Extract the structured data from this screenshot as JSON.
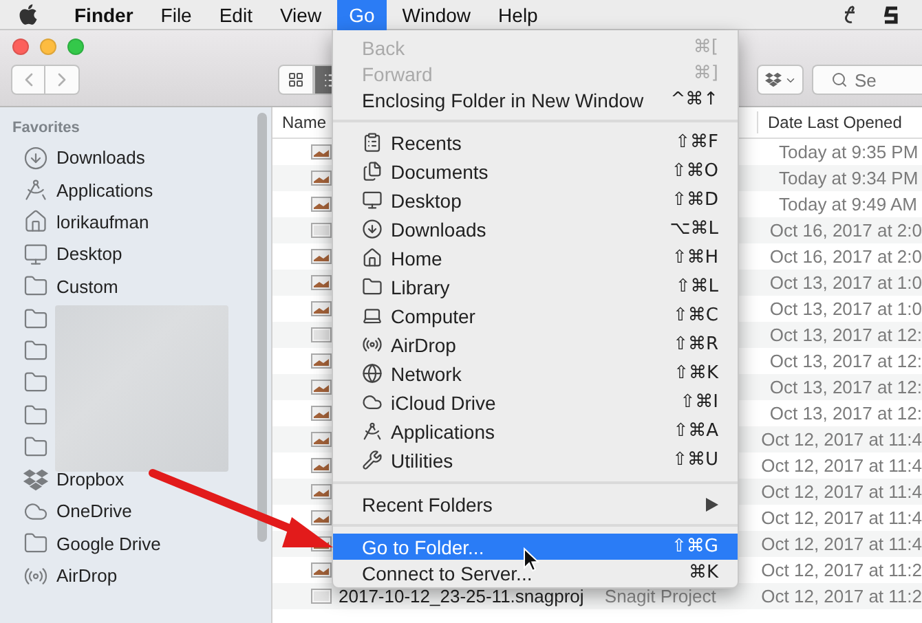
{
  "menu_bar": {
    "items": [
      {
        "label": "Finder",
        "bold": true,
        "selected": false
      },
      {
        "label": "File",
        "bold": false,
        "selected": false
      },
      {
        "label": "Edit",
        "bold": false,
        "selected": false
      },
      {
        "label": "View",
        "bold": false,
        "selected": false
      },
      {
        "label": "Go",
        "bold": false,
        "selected": true
      },
      {
        "label": "Window",
        "bold": false,
        "selected": false
      },
      {
        "label": "Help",
        "bold": false,
        "selected": false
      }
    ]
  },
  "toolbar": {
    "search": {
      "placeholder": "Se"
    }
  },
  "sidebar": {
    "section": "Favorites",
    "items": [
      {
        "label": "Downloads",
        "redacted": false
      },
      {
        "label": "Applications",
        "redacted": false
      },
      {
        "label": "lorikaufman",
        "redacted": false
      },
      {
        "label": "Desktop",
        "redacted": false
      },
      {
        "label": "Custom",
        "redacted": false
      },
      {
        "redacted": true
      },
      {
        "redacted": true
      },
      {
        "redacted": true
      },
      {
        "redacted": true
      },
      {
        "redacted": true
      },
      {
        "label": "Dropbox",
        "redacted": false
      },
      {
        "label": "OneDrive",
        "redacted": false
      },
      {
        "label": "Google Drive",
        "redacted": false
      },
      {
        "label": "AirDrop",
        "redacted": false
      }
    ]
  },
  "file_list": {
    "columns": [
      "Name",
      "Date Last Opened"
    ],
    "rows": [
      {
        "kind": "image",
        "date": "Today at 9:35 PM"
      },
      {
        "kind": "image",
        "date": "Today at 9:34 PM"
      },
      {
        "kind": "image",
        "date": "Today at 9:49 AM"
      },
      {
        "kind": "document",
        "date": "Oct 16, 2017 at 2:0"
      },
      {
        "kind": "image",
        "date": "Oct 16, 2017 at 2:0"
      },
      {
        "kind": "image",
        "date": "Oct 13, 2017 at 1:0"
      },
      {
        "kind": "image",
        "date": "Oct 13, 2017 at 1:0"
      },
      {
        "kind": "document",
        "date": "Oct 13, 2017 at 12:"
      },
      {
        "kind": "image",
        "date": "Oct 13, 2017 at 12:"
      },
      {
        "kind": "image",
        "date": "Oct 13, 2017 at 12:"
      },
      {
        "kind": "image",
        "date": "Oct 13, 2017 at 12:"
      },
      {
        "kind": "image",
        "date": "Oct 12, 2017 at 11:4"
      },
      {
        "kind": "image",
        "date": "Oct 12, 2017 at 11:4"
      },
      {
        "kind": "image",
        "date": "Oct 12, 2017 at 11:4"
      },
      {
        "kind": "image",
        "date": "Oct 12, 2017 at 11:4"
      },
      {
        "kind": "image",
        "date": "Oct 12, 2017 at 11:4"
      },
      {
        "kind": "image",
        "date": "Oct 12, 2017 at 11:2"
      },
      {
        "kind": "document",
        "name": "2017-10-12_23-25-11.snagproj",
        "type": "Snagit Project",
        "date": "Oct 12, 2017 at 11:2"
      }
    ]
  },
  "go_menu": {
    "groups": [
      [
        {
          "label": "Back",
          "shortcut": "⌘[",
          "disabled": true,
          "selected": false,
          "submenu": false
        },
        {
          "label": "Forward",
          "shortcut": "⌘]",
          "disabled": true,
          "selected": false,
          "submenu": false
        },
        {
          "label": "Enclosing Folder in New Window",
          "shortcut": "^⌘↑",
          "disabled": false,
          "selected": false,
          "submenu": false
        }
      ],
      [
        {
          "label": "Recents",
          "shortcut": "⇧⌘F",
          "disabled": false,
          "selected": false,
          "submenu": false
        },
        {
          "label": "Documents",
          "shortcut": "⇧⌘O",
          "disabled": false,
          "selected": false,
          "submenu": false
        },
        {
          "label": "Desktop",
          "shortcut": "⇧⌘D",
          "disabled": false,
          "selected": false,
          "submenu": false
        },
        {
          "label": "Downloads",
          "shortcut": "⌥⌘L",
          "disabled": false,
          "selected": false,
          "submenu": false
        },
        {
          "label": "Home",
          "shortcut": "⇧⌘H",
          "disabled": false,
          "selected": false,
          "submenu": false
        },
        {
          "label": "Library",
          "shortcut": "⇧⌘L",
          "disabled": false,
          "selected": false,
          "submenu": false
        },
        {
          "label": "Computer",
          "shortcut": "⇧⌘C",
          "disabled": false,
          "selected": false,
          "submenu": false
        },
        {
          "label": "AirDrop",
          "shortcut": "⇧⌘R",
          "disabled": false,
          "selected": false,
          "submenu": false
        },
        {
          "label": "Network",
          "shortcut": "⇧⌘K",
          "disabled": false,
          "selected": false,
          "submenu": false
        },
        {
          "label": "iCloud Drive",
          "shortcut": "⇧⌘I",
          "disabled": false,
          "selected": false,
          "submenu": false
        },
        {
          "label": "Applications",
          "shortcut": "⇧⌘A",
          "disabled": false,
          "selected": false,
          "submenu": false
        },
        {
          "label": "Utilities",
          "shortcut": "⇧⌘U",
          "disabled": false,
          "selected": false,
          "submenu": false
        }
      ],
      [
        {
          "label": "Recent Folders",
          "disabled": false,
          "selected": false,
          "submenu": true
        }
      ],
      [
        {
          "label": "Go to Folder...",
          "shortcut": "⇧⌘G",
          "disabled": false,
          "selected": true,
          "submenu": false
        },
        {
          "label": "Connect to Server...",
          "shortcut": "⌘K",
          "disabled": false,
          "selected": false,
          "submenu": false
        }
      ]
    ]
  }
}
